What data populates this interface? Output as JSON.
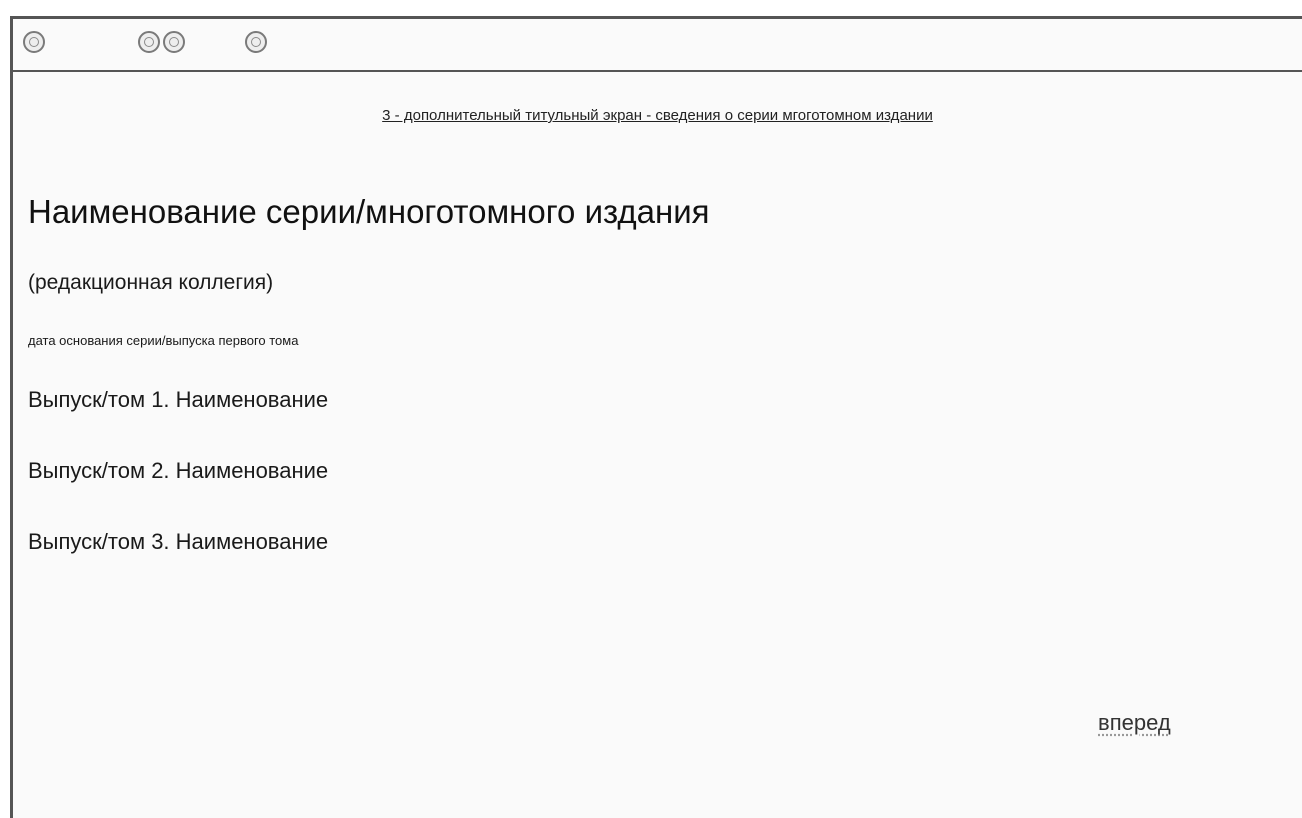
{
  "toolbar": {
    "icons": [
      {
        "name": "toolbar-round-icon"
      },
      {
        "name": "toolbar-round-icon"
      },
      {
        "name": "toolbar-round-icon"
      },
      {
        "name": "toolbar-round-icon"
      }
    ]
  },
  "screen": {
    "caption": "3 - дополнительный титульный экран - сведения о серии мгоготомном издании"
  },
  "series": {
    "title": "Наименование серии/многотомного издания",
    "editorial_board": "(редакционная коллегия)",
    "date_line": "дата основания серии/выпуска первого тома"
  },
  "volumes": [
    {
      "label": "Выпуск/том 1. Наименование"
    },
    {
      "label": "Выпуск/том 2. Наименование"
    },
    {
      "label": "Выпуск/том 3. Наименование"
    }
  ],
  "navigation": {
    "forward_label": "вперед"
  }
}
